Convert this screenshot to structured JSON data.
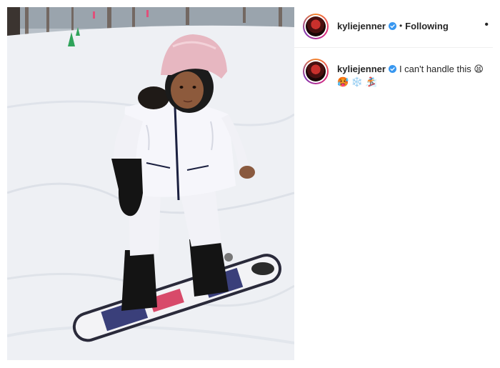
{
  "post": {
    "username": "kyliejenner",
    "follow_status": "Following",
    "separator": "•",
    "more_icon": "•",
    "caption_text": "I can't handle this",
    "caption_emojis": "😫 🥵 ❄️ 🏂",
    "verified_icon": "verified-badge-icon"
  },
  "colors": {
    "verified_blue": "#3897f0",
    "text": "#262626",
    "divider": "#efefef"
  }
}
